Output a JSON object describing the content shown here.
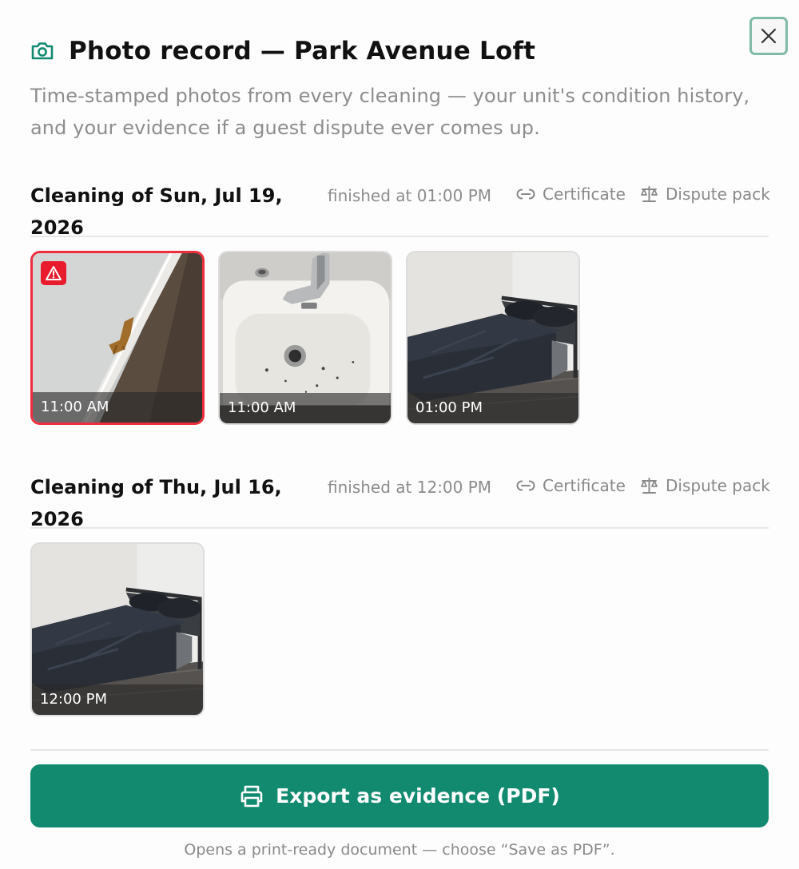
{
  "dialog": {
    "title": "Photo record — Park Avenue Loft",
    "subtitle": "Time-stamped photos from every cleaning — your unit's condition history, and your evidence if a guest dispute ever comes up.",
    "close_icon": "close-icon",
    "header_icon": "camera-icon"
  },
  "sessions": [
    {
      "title": "Cleaning of Sun, Jul 19, 2026",
      "finished": "finished at 01:00 PM",
      "certificate_label": "Certificate",
      "dispute_label": "Dispute pack",
      "photos": [
        {
          "time": "11:00 AM",
          "subject": "wall damage",
          "flagged": true
        },
        {
          "time": "11:00 AM",
          "subject": "sink",
          "flagged": false
        },
        {
          "time": "01:00 PM",
          "subject": "bed",
          "flagged": false
        }
      ]
    },
    {
      "title": "Cleaning of Thu, Jul 16, 2026",
      "finished": "finished at 12:00 PM",
      "certificate_label": "Certificate",
      "dispute_label": "Dispute pack",
      "photos": [
        {
          "time": "12:00 PM",
          "subject": "bed",
          "flagged": false
        }
      ]
    }
  ],
  "export": {
    "label": "Export as evidence (PDF)",
    "icon": "printer-icon",
    "note": "Opens a print-ready document — choose “Save as PDF”."
  },
  "colors": {
    "accent": "#128a70",
    "flag": "#e81c2c",
    "muted_text": "#8d8d8d"
  }
}
